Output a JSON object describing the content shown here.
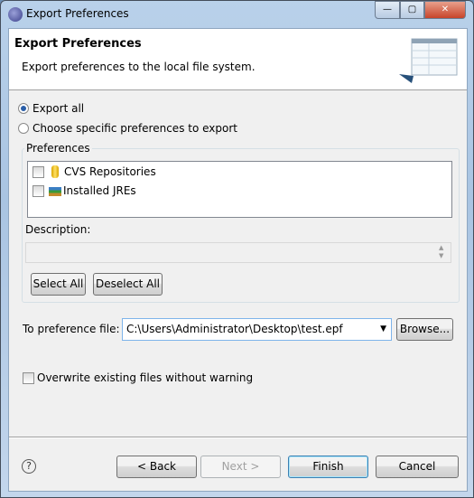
{
  "window": {
    "title": "Export Preferences",
    "controls": {
      "minimize": "—",
      "maximize": "▢",
      "close": "✕"
    }
  },
  "header": {
    "title": "Export Preferences",
    "description": "Export preferences to the local file system."
  },
  "options": {
    "export_all": "Export all",
    "choose_specific": "Choose specific preferences to export",
    "selected": "export_all"
  },
  "preferences": {
    "label": "Preferences",
    "items": [
      {
        "label": "CVS Repositories",
        "checked": false,
        "icon": "database-icon"
      },
      {
        "label": "Installed JREs",
        "checked": false,
        "icon": "jre-library-icon"
      }
    ]
  },
  "description": {
    "label": "Description:",
    "value": ""
  },
  "buttons": {
    "select_all": "Select All",
    "deselect_all": "Deselect All",
    "browse": "Browse...",
    "back": "< Back",
    "next": "Next >",
    "finish": "Finish",
    "cancel": "Cancel",
    "help": "?"
  },
  "file": {
    "label": "To preference file:",
    "value": "C:\\Users\\Administrator\\Desktop\\test.epf"
  },
  "overwrite": {
    "label": "Overwrite existing files without warning",
    "checked": false
  }
}
